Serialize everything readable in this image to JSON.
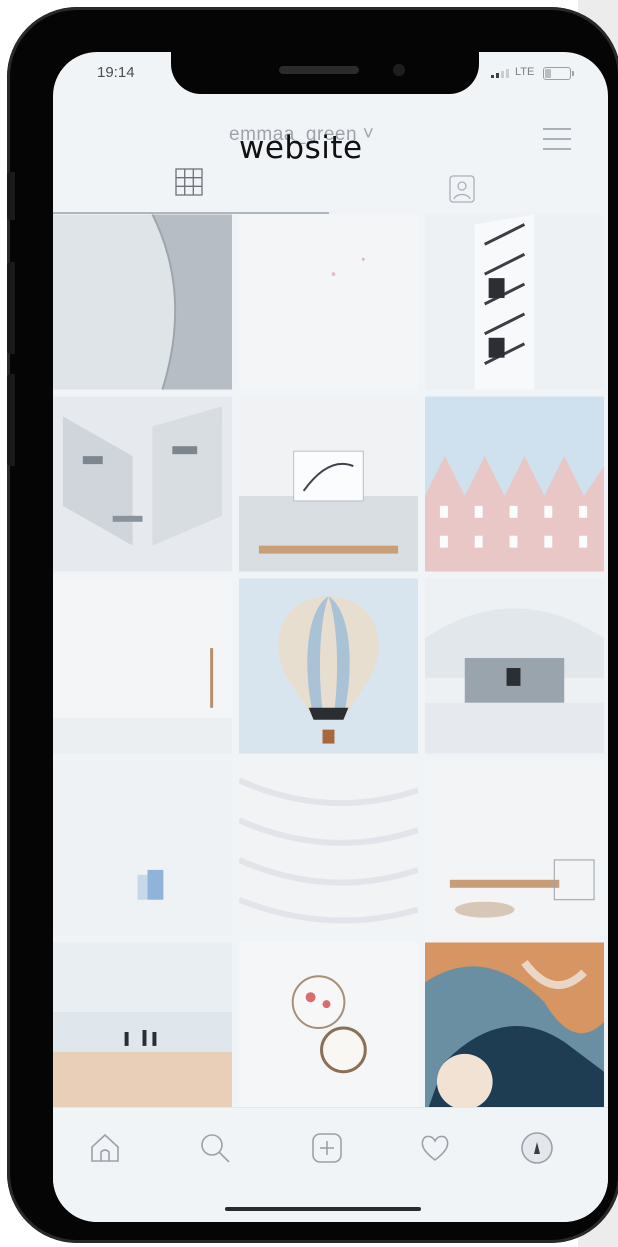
{
  "status_bar": {
    "time": "19:14",
    "network": "LTE"
  },
  "profile": {
    "username": "emmaa_green ˅",
    "overlay_title": "website"
  },
  "tabs": {
    "grid": "grid-icon",
    "tagged": "tagged-icon"
  },
  "nav": {
    "items": [
      "home-icon",
      "search-icon",
      "add-post-icon",
      "heart-icon",
      "profile-avatar"
    ]
  },
  "colors": {
    "screen_bg": "#f1f4f7",
    "phone_frame": "#050505",
    "title_text": "#111111",
    "muted_text": "#9ea4ab"
  }
}
